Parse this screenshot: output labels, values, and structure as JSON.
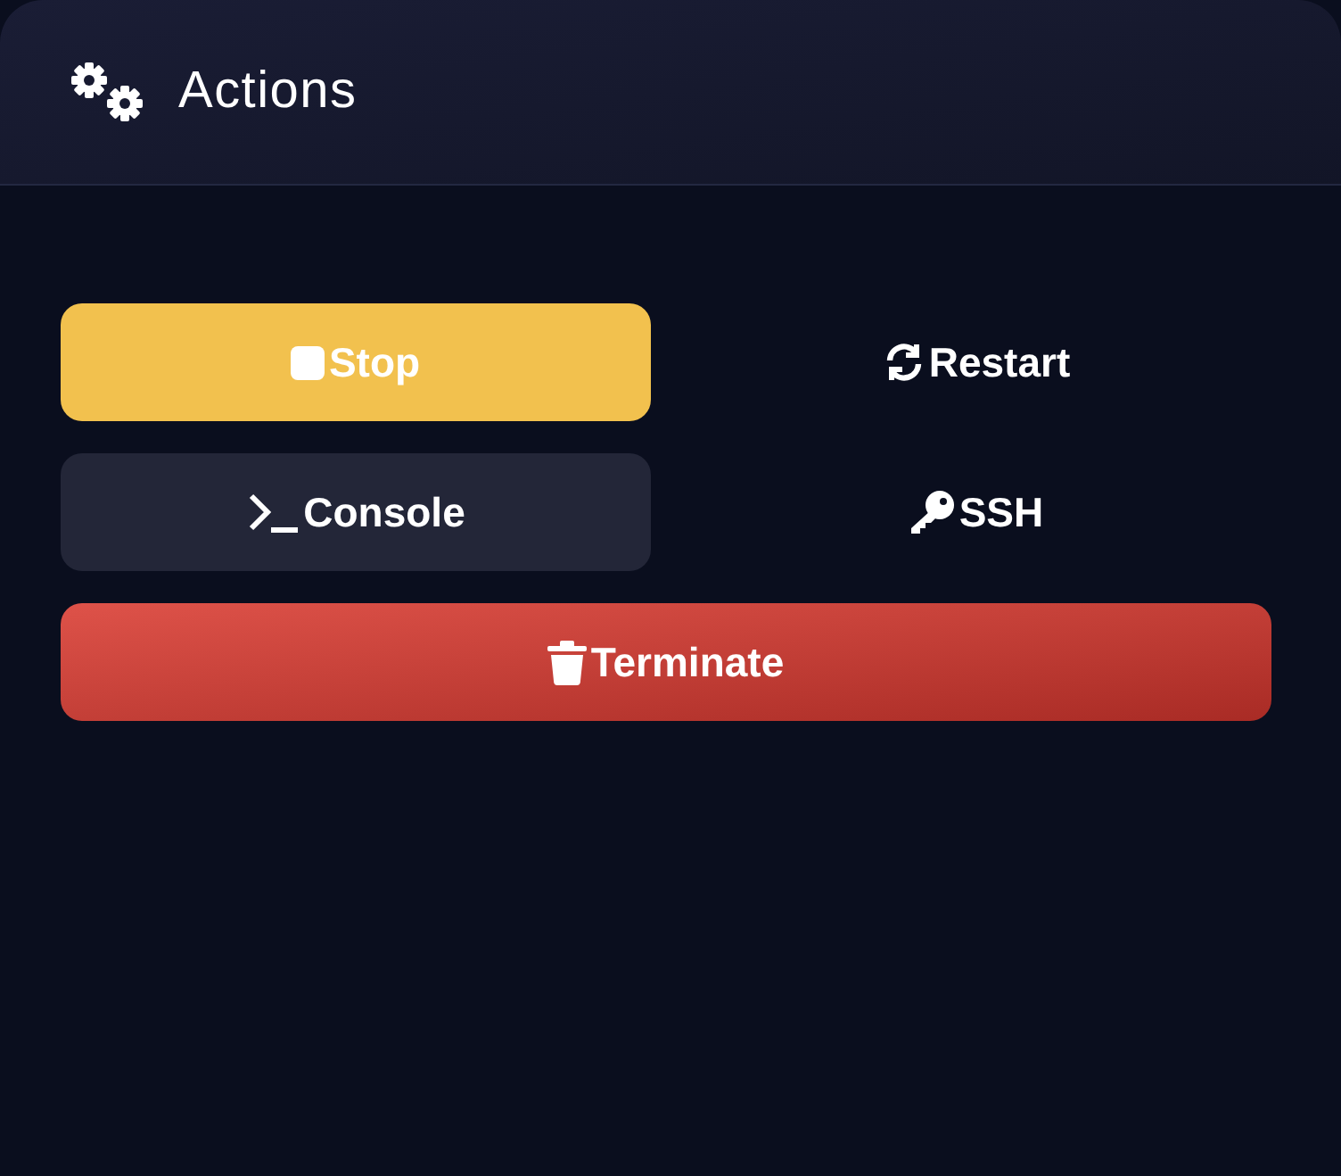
{
  "panel": {
    "title": "Actions"
  },
  "buttons": [
    {
      "label": "Stop",
      "kind": "warning",
      "wide": false
    },
    {
      "label": "Restart",
      "kind": "ghost",
      "wide": false
    },
    {
      "label": "Console",
      "kind": "secondary",
      "wide": false
    },
    {
      "label": "SSH",
      "kind": "ghost",
      "wide": false
    },
    {
      "label": "Terminate",
      "kind": "danger",
      "wide": true
    }
  ]
}
